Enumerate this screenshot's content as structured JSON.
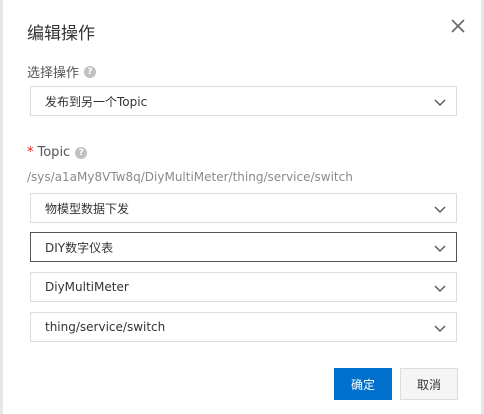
{
  "dialog": {
    "title": "编辑操作",
    "operation_label": "选择操作",
    "operation_value": "发布到另一个Topic",
    "topic_label": "Topic",
    "required_mark": "*",
    "topic_path": "/sys/a1aMy8VTw8q/DiyMultiMeter/thing/service/switch",
    "topic_selects": [
      "物模型数据下发",
      "DIY数字仪表",
      "DiyMultiMeter",
      "thing/service/switch"
    ],
    "ok_label": "确定",
    "cancel_label": "取消",
    "help_glyph": "?"
  },
  "icons": {
    "close": "close-icon",
    "chevron": "chevron-down-icon",
    "help": "help-icon"
  },
  "colors": {
    "primary": "#0070cc",
    "required": "#e2231a"
  }
}
